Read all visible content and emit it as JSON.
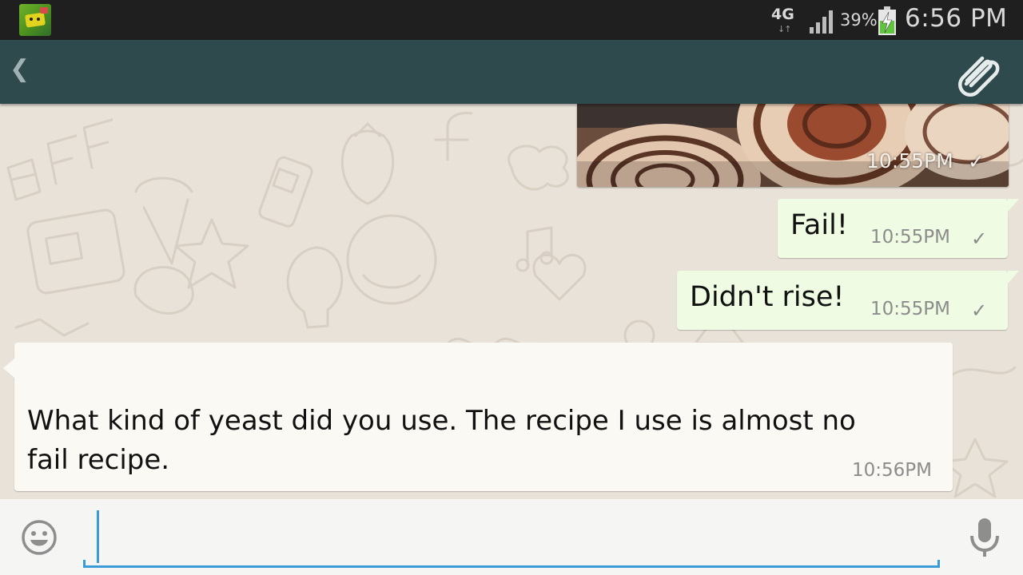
{
  "status_bar": {
    "network": "4G",
    "network_arrows": "↓↑",
    "battery": "39%",
    "time": "6:56 PM"
  },
  "action_bar": {
    "back_glyph": "❮",
    "attach_icon": "paperclip-icon"
  },
  "messages": [
    {
      "type": "image",
      "direction": "outgoing",
      "time": "10:55PM",
      "status": "✓"
    },
    {
      "type": "text",
      "direction": "outgoing",
      "text": "Fail!",
      "time": "10:55PM",
      "status": "✓"
    },
    {
      "type": "text",
      "direction": "outgoing",
      "text": "Didn't rise!",
      "time": "10:55PM",
      "status": "✓"
    },
    {
      "type": "text",
      "direction": "incoming",
      "lines": [
        "What kind of yeast did you use. The recipe I use is almost no",
        "fail recipe."
      ],
      "time": "10:56PM"
    }
  ],
  "input_bar": {
    "placeholder": "",
    "value": "",
    "emoji_icon": "emoji-smiley-icon",
    "mic_icon": "microphone-icon"
  },
  "colors": {
    "action_bar": "#2f4a4c",
    "outgoing_bubble": "#effbe3",
    "incoming_bubble": "#fbf9f4",
    "input_accent": "#3a9cd6"
  }
}
